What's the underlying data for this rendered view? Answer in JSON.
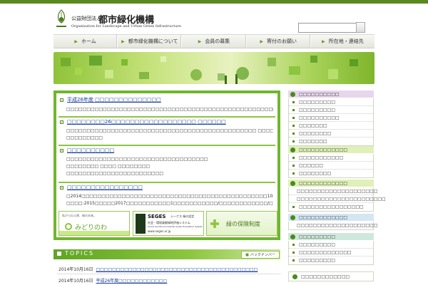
{
  "header": {
    "org_prefix": "公益財団法人",
    "org_name": "都市緑化機構",
    "org_en": "Organization for Landscape and Urban Green Infrastructure",
    "search_placeholder": ""
  },
  "nav": {
    "items": [
      {
        "label": "ホーム"
      },
      {
        "label": "都市緑化機構について"
      },
      {
        "label": "会員の募集"
      },
      {
        "label": "寄付のお願い"
      },
      {
        "label": "所在地・連絡先"
      }
    ]
  },
  "news": {
    "items": [
      {
        "title": "平成26年度 □□□□□□□□□□□□□□",
        "body": [
          "□□□□□□□□□□□□□□□□□□□□□□□□□□□□□□□□□□□□□□□□□□□□□□□□□□□□□"
        ]
      },
      {
        "title": "□□□□□□□□26□□□□□□□□□□□□□□□□□□ □□□□□□",
        "body": [
          "□□□□□□□□□□□□□□□□□□□□□□□□□□□□□□□□□□□□□□□□□□□□□□□ □□□□□□□□□□□□□□□□□□",
          "□□□□□□□□□"
        ]
      },
      {
        "title": "□□□□□□□□□□",
        "body": [
          "□□□□□□□□□□□□□□□□□□□□□□□□□□□□□□□□□□□",
          "□□□□□□□□ □□□□ □□□□□□□□",
          "□□□□□□□□□□□□□□□□□□□□□□□□"
        ]
      },
      {
        "title": "□□□□□□□□□□□□□□□□",
        "body": [
          "□2014□□□□□□□□□□□□□□□□□□□□□□□□□□□□□□□□□□□□□□□□□□□□□□10□19□□",
          "□□□□:2015□□□□□2017□□□□□□□□□□□1□□□□□□□□□□□/□□□□□□□□□□□□/□"
        ]
      }
    ]
  },
  "banners": {
    "midori_caption": "私から伝え隊、緑の未来。",
    "midori_name": "みどりのわ",
    "seges_name": "SEGES",
    "seges_sub": "シーゲス 緑の認定",
    "seges_line2": "社会・環境貢献緑地評価システム",
    "seges_en": "Social and Environmental Green Evaluation System",
    "seges_url": "www.seges.or.jp",
    "hoken": "緑の保険制度"
  },
  "topics": {
    "label": "TOPICS",
    "back_label": "バックナンバー",
    "rows": [
      {
        "date": "2014年10月16日",
        "title": "□□□□□□□□□□□□□□□□□□□□□□□□□□□□□□□□□□□□□□□□"
      },
      {
        "date": "2014年10月16日",
        "title": "平成26年度□□□□□□□□□□□□"
      }
    ]
  },
  "sidebar": {
    "sections": [
      {
        "title": "□□□□□□□□□□",
        "color": "#e8d6ec",
        "items": [
          "□□□□□□□□□",
          "□□□□□□□□□",
          "□□□□□□□□□□",
          "□□□□□□□",
          "□□□□□□□□",
          "□□□□□□□"
        ]
      },
      {
        "title": "□□□□□□□□□□□□",
        "color": "#dff0b8",
        "items": [
          "□□□□□□□□□□□",
          "□□□□□□",
          "□□□□□□□□"
        ]
      },
      {
        "title": "□□□□□□□□□□□□",
        "color": "#dff0b8",
        "items": [
          "□□□□□□□□□□□□□□□□□□□□",
          "□□□□□□□□□□□□□□□□□□□□□□",
          "□□□□□□□□□□□□□□□□"
        ]
      },
      {
        "title": "□□□□□□□□□□□□",
        "color": "#d4e6f2",
        "items": [
          "□□□□□□□□□□□□□□□□□□□□"
        ]
      },
      {
        "title": "□□□□□□□□□",
        "color": "#cfe8dd",
        "items": [
          "□□□□□□□□□",
          "□□□□□□□□□□□□□",
          "□□□□□□□□□"
        ]
      }
    ],
    "footer_link": "□□□□□□□□□□□□"
  }
}
